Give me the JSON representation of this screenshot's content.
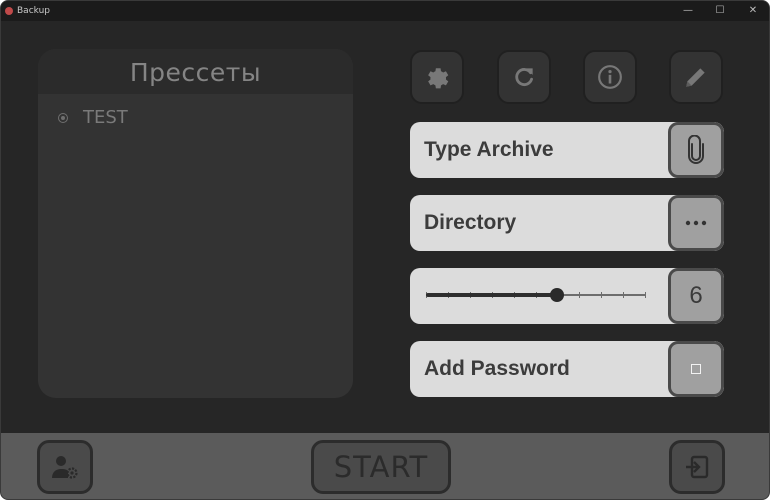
{
  "window": {
    "title": "Backup",
    "minimize_glyph": "—",
    "maximize_glyph": "☐",
    "close_glyph": "✕"
  },
  "presets": {
    "title": "Прессеты",
    "items": [
      {
        "label": "TEST",
        "selected": true
      }
    ]
  },
  "toolbar": {
    "icons": [
      "gear-icon",
      "refresh-icon",
      "info-icon",
      "pencil-icon"
    ]
  },
  "fields": {
    "archive_type": {
      "label": "Type Archive",
      "icon": "paperclip-icon"
    },
    "directory": {
      "label": "Directory",
      "icon": "more-dots-icon"
    },
    "compression": {
      "value": "6",
      "level_fraction": 0.6,
      "steps": 10
    },
    "password": {
      "label": "Add Password",
      "checked": false
    }
  },
  "bottom": {
    "start_label": "START",
    "left_icon": "user-settings-icon",
    "right_icon": "exit-icon"
  },
  "colors": {
    "background": "#262626",
    "panel": "#333333",
    "field": "#dcdcdc",
    "bottom_bar": "#5b5b5b"
  }
}
